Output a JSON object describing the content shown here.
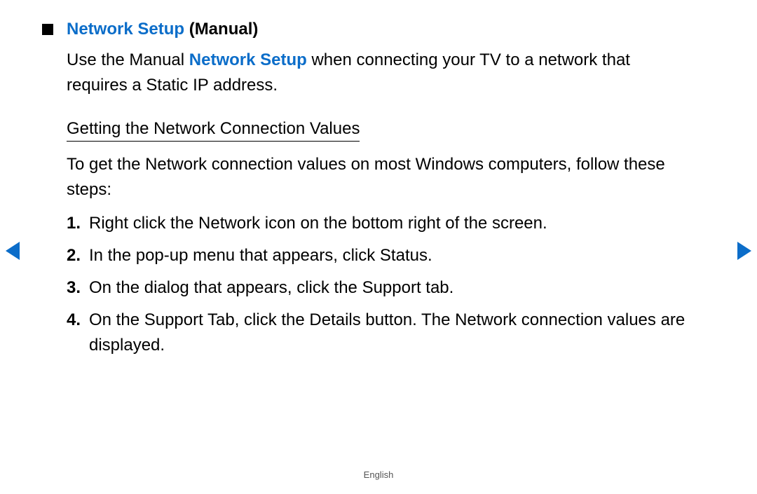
{
  "title": {
    "blue": "Network Setup",
    "black": " (Manual)"
  },
  "intro": {
    "p1": "Use the Manual ",
    "blue": "Network Setup",
    "p2": " when connecting your TV to a network that requires a Static IP address."
  },
  "subheading": "Getting the Network Connection Values",
  "subintro": "To get the Network connection values on most Windows computers, follow these steps:",
  "steps": [
    "Right click the Network icon on the bottom right of the screen.",
    "In the pop-up menu that appears, click Status.",
    "On the dialog that appears, click the Support tab.",
    "On the Support Tab, click the Details button. The Network connection values are displayed."
  ],
  "footer": "English"
}
